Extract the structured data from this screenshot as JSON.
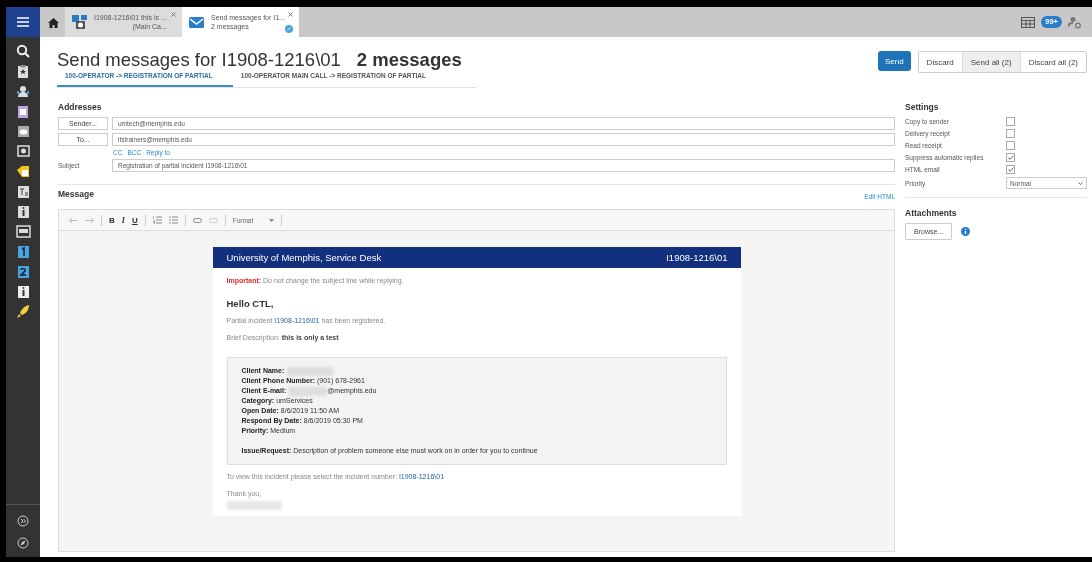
{
  "tabs": [
    {
      "title": "I1908-1216\\01 this is ...",
      "subtitle": "(Main Ca...",
      "kind": "incident",
      "selected": false
    },
    {
      "title": "Send messages for I1...",
      "subtitle": "2 messages",
      "kind": "mail",
      "selected": true
    }
  ],
  "notification_badge": "99+",
  "page": {
    "title": "Send messages for I1908-1216\\01",
    "count": "2 messages"
  },
  "message_tabs": [
    {
      "label": "100-OPERATOR -> REGISTRATION OF PARTIAL",
      "selected": true
    },
    {
      "label": "100-OPERATOR MAIN CALL -> REGISTRATION OF PARTIAL",
      "selected": false
    }
  ],
  "actions": [
    {
      "label": "Send",
      "kind": "primary",
      "highlighted": false
    },
    {
      "label": "Discard",
      "kind": "group",
      "highlighted": false
    },
    {
      "label": "Send all (2)",
      "kind": "group",
      "highlighted": true
    },
    {
      "label": "Discard all (2)",
      "kind": "group",
      "highlighted": false
    }
  ],
  "addresses": {
    "heading": "Addresses",
    "rows": [
      {
        "button": "Sender...",
        "value": "umtech@memphis.edu"
      },
      {
        "button": "To...",
        "value": "itstrainers@memphis.edu"
      }
    ],
    "links": [
      "CC",
      "BCC",
      "Reply to"
    ],
    "subject": {
      "label": "Subject",
      "value": "Registration of partial incident I1908-1216\\01"
    }
  },
  "message": {
    "heading": "Message",
    "edit_html": "Edit HTML",
    "format_buttons": [
      "B",
      "I",
      "U"
    ],
    "format_dropdown": "Format",
    "email": {
      "header_left": "University of Memphis, Service Desk",
      "header_right": "I1908-1216\\01",
      "important": "**Important:** Do not change the subject line while replying.",
      "greeting": "Hello CTL,",
      "registered": {
        "before": "Partial incident",
        "link": "I1908-1216\\01",
        "after": "has been registered."
      },
      "brief": "Brief Description: **this is only a test**",
      "details": [
        {
          "label": "Client Name:",
          "redacted": true
        },
        {
          "text": "**Client Phone Number:** (901) 678-2961"
        },
        {
          "label": "Client E-mail:",
          "redacted": true,
          "suffix": "@memphis.edu"
        },
        {
          "text": "**Category:** umServices"
        },
        {
          "text": "**Open Date:** 8/6/2019 11:50 AM"
        },
        {
          "text": "**Respond By Date:** 8/6/2019 05:30 PM"
        },
        {
          "text": "**Priority:** Medium"
        }
      ],
      "issue": "**Issue/Request:** Description of problem someone else must work on in order for you to continue",
      "view": {
        "text": "To view this incident please select the incident number:",
        "link": "I1908-1216\\01"
      },
      "thanks": "Thank you,",
      "signature_redacted": true
    }
  },
  "settings": {
    "heading": "Settings",
    "options": [
      {
        "label": "Copy to sender",
        "checked": false
      },
      {
        "label": "Delivery receipt",
        "checked": false
      },
      {
        "label": "Read receipt",
        "checked": false
      },
      {
        "label": "Suppress automatic replies",
        "checked": true
      },
      {
        "label": "HTML email",
        "checked": true
      }
    ],
    "priority": {
      "label": "Priority",
      "value": "Normal"
    }
  },
  "attachments": {
    "heading": "Attachments",
    "button": "Browse..."
  }
}
